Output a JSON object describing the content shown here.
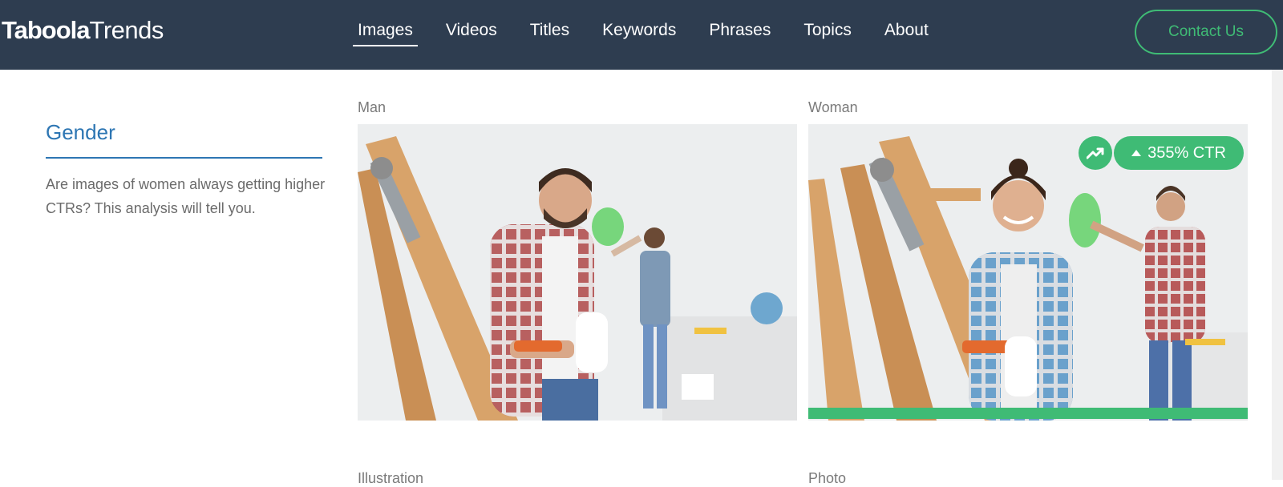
{
  "header": {
    "logo_bold": "Taboola",
    "logo_light": "Trends",
    "nav": [
      {
        "label": "Images",
        "active": true
      },
      {
        "label": "Videos",
        "active": false
      },
      {
        "label": "Titles",
        "active": false
      },
      {
        "label": "Keywords",
        "active": false
      },
      {
        "label": "Phrases",
        "active": false
      },
      {
        "label": "Topics",
        "active": false
      },
      {
        "label": "About",
        "active": false
      }
    ],
    "contact_label": "Contact Us"
  },
  "sidebar": {
    "title": "Gender",
    "description": "Are images of women always getting higher CTRs? This analysis will tell you."
  },
  "comparison": {
    "left_label": "Man",
    "right_label": "Woman",
    "badge_icon": "trending-up-icon",
    "badge_text": "355% CTR",
    "winner": "Woman"
  },
  "next_section": {
    "left_label": "Illustration",
    "right_label": "Photo"
  },
  "colors": {
    "header_bg": "#2e3d50",
    "accent_green": "#3fbb75",
    "title_blue": "#2d76b3"
  }
}
